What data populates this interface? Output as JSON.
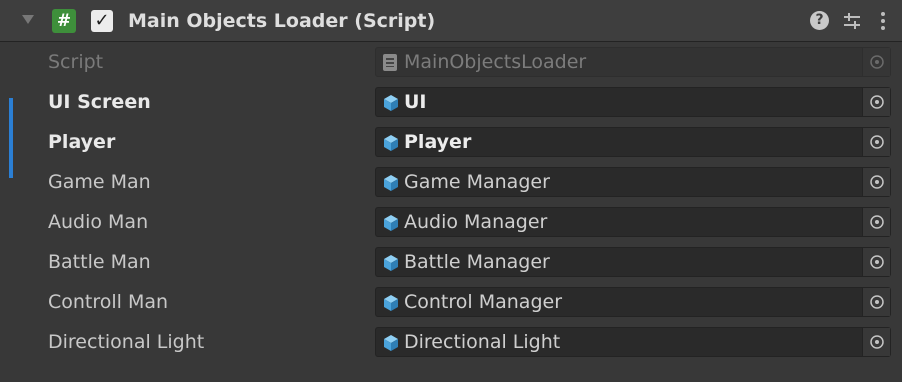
{
  "component": {
    "title": "Main Objects Loader (Script)",
    "script_icon_glyph": "#",
    "enabled": true,
    "check_glyph": "✓",
    "help_glyph": "?",
    "icons": {
      "fold": "foldout-arrow-icon",
      "script": "csharp-script-icon",
      "help": "help-icon",
      "presets": "presets-sliders-icon",
      "menu": "kebab-menu-icon"
    }
  },
  "properties": [
    {
      "label": "Script",
      "value": "MainObjectsLoader",
      "icon": "script-file-icon",
      "state": "disabled"
    },
    {
      "label": "UI Screen",
      "value": "UI",
      "icon": "prefab-cube-icon",
      "state": "overridden"
    },
    {
      "label": "Player",
      "value": "Player",
      "icon": "prefab-cube-icon",
      "state": "overridden"
    },
    {
      "label": "Game Man",
      "value": "Game Manager",
      "icon": "prefab-cube-icon",
      "state": "normal"
    },
    {
      "label": "Audio Man",
      "value": "Audio Manager",
      "icon": "prefab-cube-icon",
      "state": "normal"
    },
    {
      "label": "Battle Man",
      "value": "Battle Manager",
      "icon": "prefab-cube-icon",
      "state": "normal"
    },
    {
      "label": "Controll Man",
      "value": "Control Manager",
      "icon": "prefab-cube-icon",
      "state": "normal"
    },
    {
      "label": "Directional Light",
      "value": "Directional Light",
      "icon": "prefab-cube-icon",
      "state": "normal"
    }
  ],
  "colors": {
    "background": "#383838",
    "header": "#3e3e3e",
    "field": "#2a2a2a",
    "accent_override": "#2b7fd4",
    "script_icon": "#3e8f3b",
    "prefab_icon": "#5fb2e8"
  }
}
